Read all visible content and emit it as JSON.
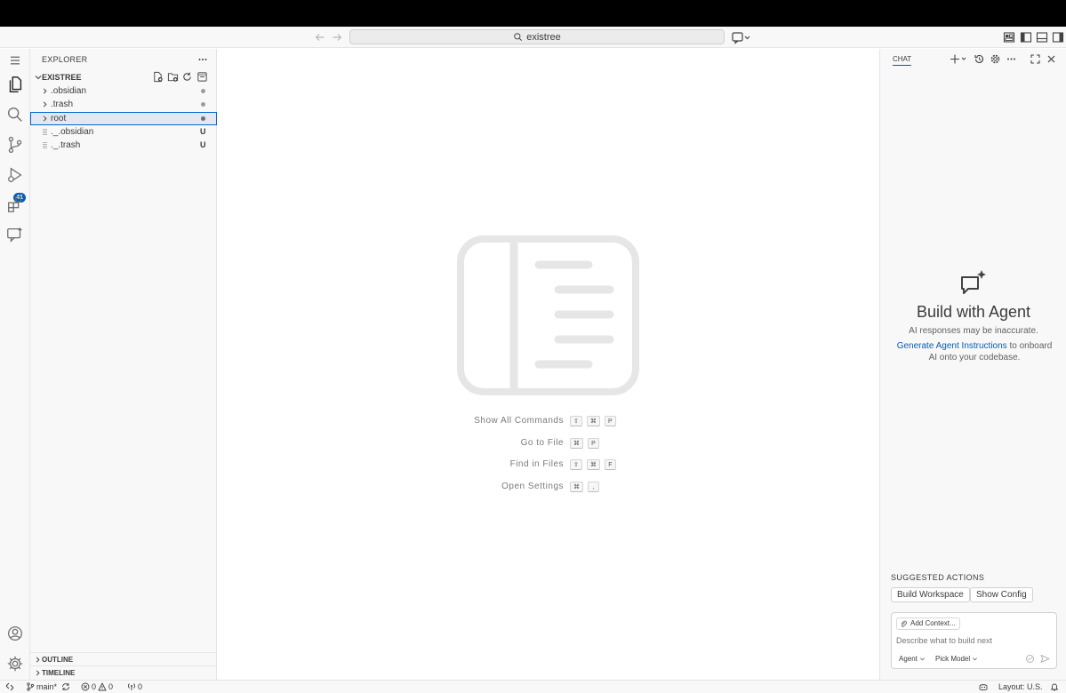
{
  "titlebar": {
    "search_text": "existree"
  },
  "activity": {
    "scm_badge": "41"
  },
  "explorer": {
    "header": "EXPLORER",
    "folder_name": "EXISTREE",
    "items": [
      {
        "label": ".obsidian",
        "kind": "folder",
        "status": "dot"
      },
      {
        "label": ".trash",
        "kind": "folder",
        "status": "dot"
      },
      {
        "label": "root",
        "kind": "folder",
        "status": "dot",
        "selected": true
      },
      {
        "label": "._.obsidian",
        "kind": "file",
        "status": "U"
      },
      {
        "label": "._.trash",
        "kind": "file",
        "status": "U"
      }
    ],
    "outline_label": "OUTLINE",
    "timeline_label": "TIMELINE"
  },
  "editor": {
    "hints": [
      {
        "label": "Show All Commands",
        "keys": [
          "⇧",
          "⌘",
          "P"
        ]
      },
      {
        "label": "Go to File",
        "keys": [
          "⌘",
          "P"
        ]
      },
      {
        "label": "Find in Files",
        "keys": [
          "⇧",
          "⌘",
          "F"
        ]
      },
      {
        "label": "Open Settings",
        "keys": [
          "⌘",
          ","
        ]
      }
    ]
  },
  "chat": {
    "tab_label": "CHAT",
    "title": "Build with Agent",
    "subtitle": "AI responses may be inaccurate.",
    "desc_link": "Generate Agent Instructions",
    "desc_rest": " to onboard AI onto your codebase.",
    "suggested_header": "SUGGESTED ACTIONS",
    "suggested": [
      "Build Workspace",
      "Show Config"
    ],
    "add_context": "Add Context...",
    "input_placeholder": "Describe what to build next",
    "mode": "Agent",
    "model": "Pick Model"
  },
  "statusbar": {
    "branch": "main*",
    "errors": "0",
    "warnings": "0",
    "ports": "0",
    "layout": "Layout: U.S."
  },
  "colors": {
    "accent": "#005fb8",
    "selection_border": "#0069d1",
    "chrome_bg": "#f8f8f8"
  }
}
